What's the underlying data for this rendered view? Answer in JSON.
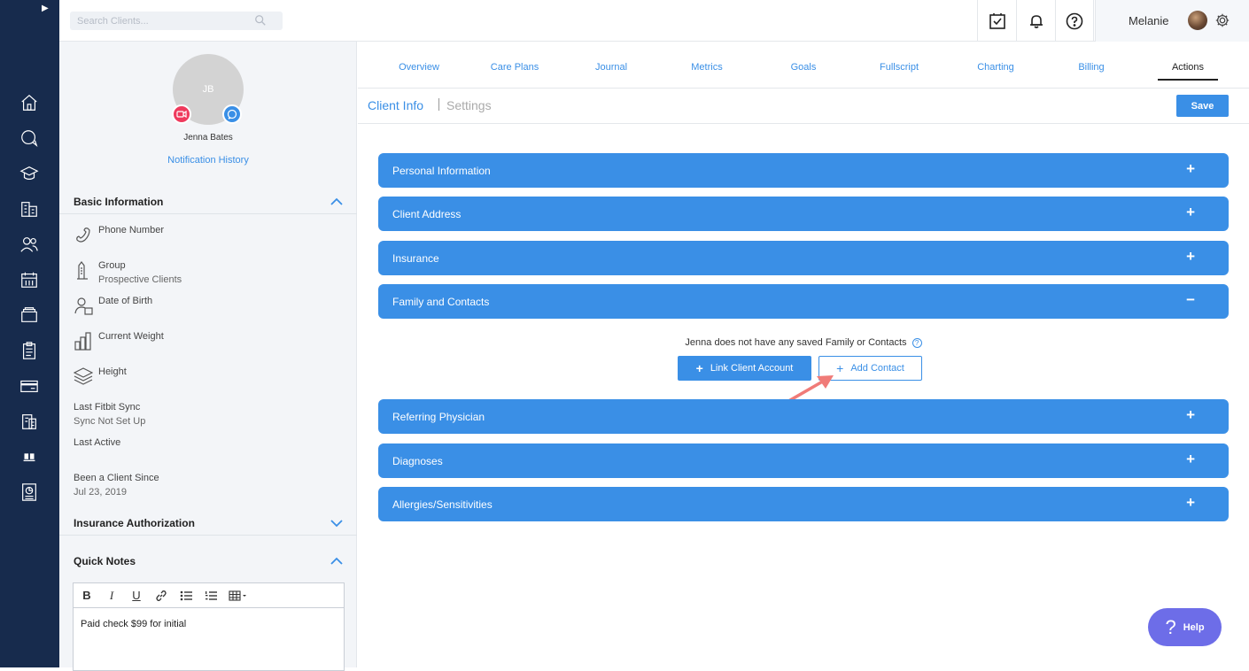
{
  "search": {
    "placeholder": "Search Clients..."
  },
  "user": {
    "name": "Melanie"
  },
  "client": {
    "initials": "JB",
    "name": "Jenna Bates",
    "notification_link": "Notification History"
  },
  "basic_info": {
    "title": "Basic Information",
    "phone_label": "Phone Number",
    "group_label": "Group",
    "group_value": "Prospective Clients",
    "dob_label": "Date of Birth",
    "weight_label": "Current Weight",
    "height_label": "Height",
    "fitbit_label": "Last Fitbit Sync",
    "fitbit_value": "Sync Not Set Up",
    "last_active_label": "Last Active",
    "client_since_label": "Been a Client Since",
    "client_since_value": "Jul 23, 2019"
  },
  "insurance_auth": {
    "title": "Insurance Authorization"
  },
  "quick_notes": {
    "title": "Quick Notes",
    "content": "Paid check $99 for initial"
  },
  "tabs": [
    "Overview",
    "Care Plans",
    "Journal",
    "Metrics",
    "Goals",
    "Fullscript",
    "Charting",
    "Billing",
    "Actions"
  ],
  "active_tab": "Actions",
  "subtabs": {
    "client_info": "Client Info",
    "settings": "Settings"
  },
  "save_label": "Save",
  "accordions": [
    {
      "label": "Personal Information",
      "sign": "+"
    },
    {
      "label": "Client Address",
      "sign": "+"
    },
    {
      "label": "Insurance",
      "sign": "+"
    },
    {
      "label": "Family and Contacts",
      "sign": "−"
    },
    {
      "label": "Referring Physician",
      "sign": "+"
    },
    {
      "label": "Diagnoses",
      "sign": "+"
    },
    {
      "label": "Allergies/Sensitivities",
      "sign": "+"
    }
  ],
  "family_contacts": {
    "empty_message": "Jenna does not have any saved Family or Contacts",
    "link_button": "Link Client Account",
    "add_button": "Add Contact"
  },
  "help": {
    "label": "Help",
    "glyph": "?"
  },
  "colors": {
    "accent": "#3a8fe6",
    "rail": "#172b4d",
    "help": "#6d6de8",
    "arrow": "#f07b78",
    "video": "#ef3a5d"
  }
}
